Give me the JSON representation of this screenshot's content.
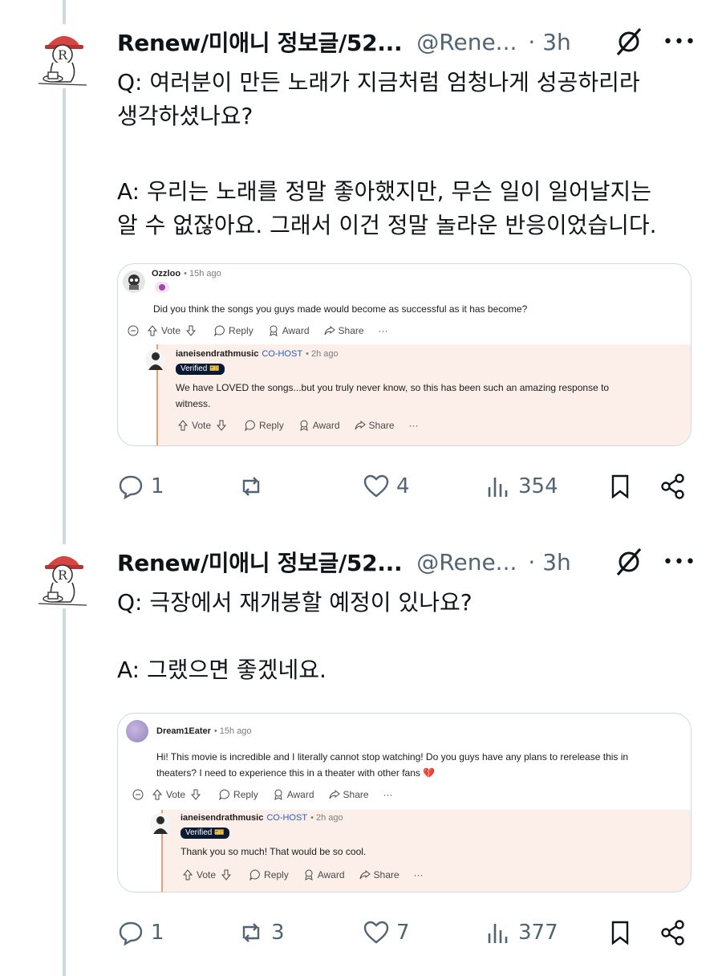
{
  "tweets": [
    {
      "author_name": "Renew/미애니 정보글/52...",
      "handle": "@Rene...",
      "time": "· 3h",
      "question": "Q: 여러분이 만든 노래가 지금처럼 엄청나게 성공하리라\n생각하셨나요?",
      "answer": "A: 우리는 노래를 정말 좋아했지만, 무슨 일이 일어날지는\n알 수 없잖아요. 그래서 이건 정말 놀라운 반응이었습니다.",
      "card": {
        "commenter": "Ozzloo",
        "commenter_time": "• 15h ago",
        "comment": "Did you think the songs you guys made would become as successful as it has become?",
        "reply_user": "ianeisendrathmusic",
        "reply_badge": "CO-HOST",
        "reply_time": "• 2h ago",
        "verified": "Verified 🎫",
        "reply": "We have LOVED the songs...but you truly never know, so this has been such an amazing response to\nwitness."
      },
      "stats": {
        "replies": "1",
        "reposts": "",
        "likes": "4",
        "views": "354"
      }
    },
    {
      "author_name": "Renew/미애니 정보글/52...",
      "handle": "@Rene...",
      "time": "· 3h",
      "question": "Q: 극장에서 재개봉할 예정이 있나요?",
      "answer": "A: 그랬으면 좋겠네요.",
      "card": {
        "commenter": "Dream1Eater",
        "commenter_time": "• 15h ago",
        "comment": "Hi! This movie is incredible and I literally cannot stop watching! Do you guys have any plans to rerelease this in\ntheaters? I need to experience this in a theater with other fans 💔",
        "reply_user": "ianeisendrathmusic",
        "reply_badge": "CO-HOST",
        "reply_time": "• 2h ago",
        "verified": "Verified 🎫",
        "reply": "Thank you so much! That would be so cool."
      },
      "stats": {
        "replies": "1",
        "reposts": "3",
        "likes": "7",
        "views": "377"
      }
    }
  ],
  "card_actions": {
    "vote": "Vote",
    "reply": "Reply",
    "award": "Award",
    "share": "Share",
    "more": "···"
  },
  "more_menu": "•••",
  "colors": {
    "text": "#0f1419",
    "muted": "#536471",
    "border": "#cfd9de",
    "reply_bg": "#fcefe9",
    "reply_line": "#e8a27a",
    "cohost": "#2760c8"
  },
  "icons": [
    "avatar-cat",
    "grok-icon",
    "more-icon",
    "reply-icon",
    "repost-icon",
    "like-icon",
    "views-icon",
    "bookmark-icon",
    "share-icon",
    "upvote-icon",
    "downvote-icon",
    "comment-icon",
    "award-icon",
    "share-arrow-icon",
    "collapse-icon"
  ]
}
